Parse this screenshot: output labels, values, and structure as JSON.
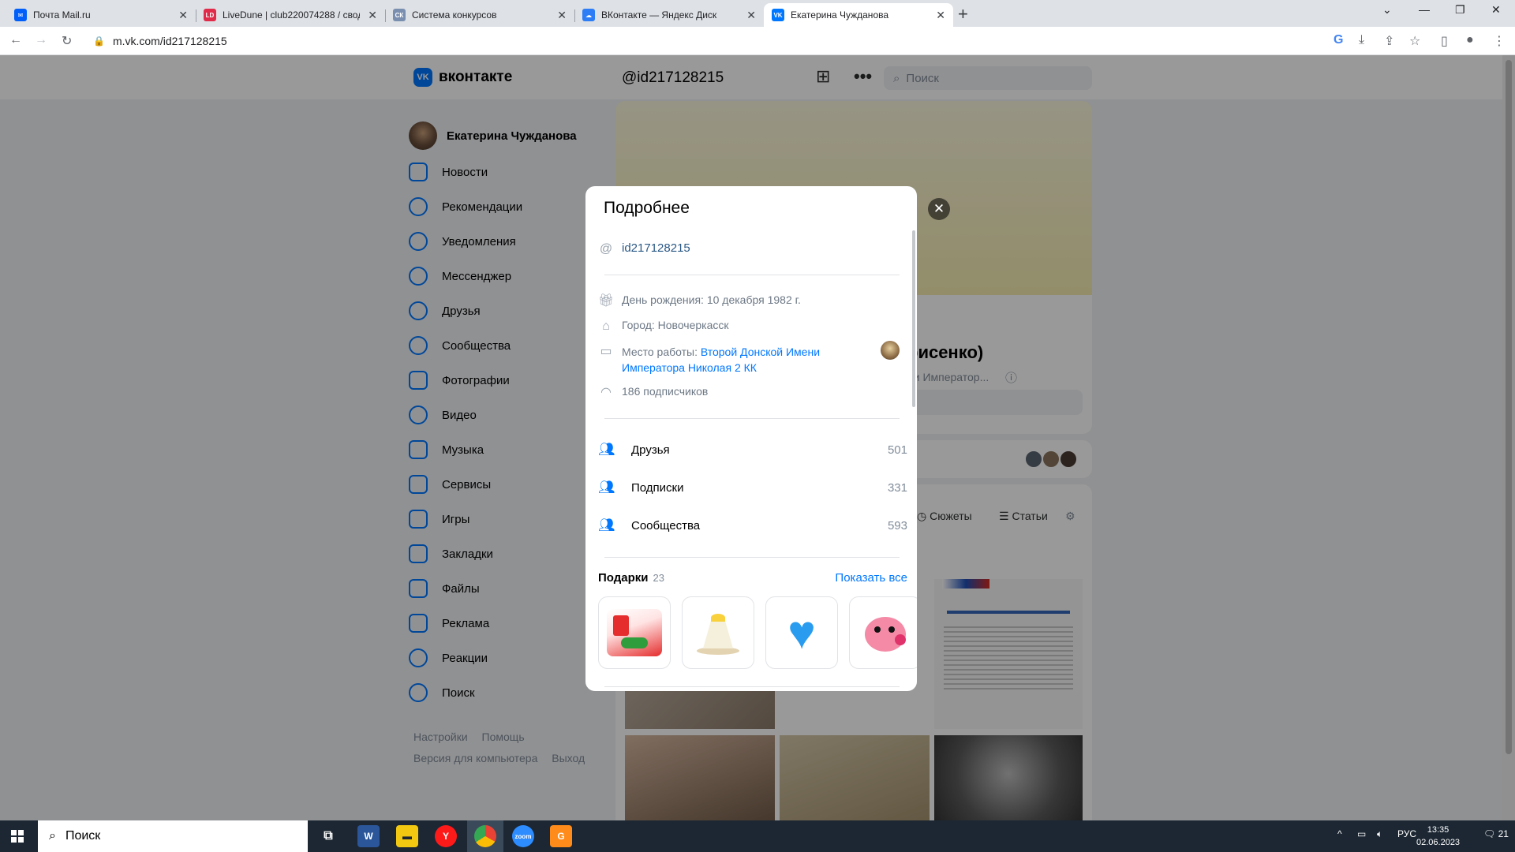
{
  "browser": {
    "tabs": [
      {
        "label": "Почта Mail.ru",
        "favicon_color": "#005ff9",
        "favicon_letter": "✉"
      },
      {
        "label": "LiveDune | club220074288 / свод",
        "favicon_color": "#e02b4a",
        "favicon_letter": "LD"
      },
      {
        "label": "Система конкурсов",
        "favicon_color": "#7a8fb0",
        "favicon_letter": "СК"
      },
      {
        "label": "ВКонтакте — Яндекс Диск",
        "favicon_color": "#2d7df6",
        "favicon_letter": "☁"
      },
      {
        "label": "Екатерина Чужданова",
        "favicon_color": "#0077ff",
        "favicon_letter": "VK"
      }
    ],
    "url": "m.vk.com/id217128215"
  },
  "vk_header": {
    "logo_text": "вконтакте",
    "handle": "@id217128215",
    "search_placeholder": "Поиск"
  },
  "sidebar": {
    "user_name": "Екатерина Чужданова",
    "items": [
      {
        "label": "Новости"
      },
      {
        "label": "Рекомендации"
      },
      {
        "label": "Уведомления"
      },
      {
        "label": "Мессенджер"
      },
      {
        "label": "Друзья"
      },
      {
        "label": "Сообщества"
      },
      {
        "label": "Фотографии"
      },
      {
        "label": "Видео"
      },
      {
        "label": "Музыка"
      },
      {
        "label": "Сервисы"
      },
      {
        "label": "Игры"
      },
      {
        "label": "Закладки"
      },
      {
        "label": "Файлы"
      },
      {
        "label": "Реклама"
      },
      {
        "label": "Реакции"
      },
      {
        "label": "Поиск"
      }
    ],
    "footer": {
      "settings": "Настройки",
      "help": "Помощь",
      "desktop": "Версия для компьютера",
      "logout": "Выход"
    }
  },
  "profile_behind": {
    "name_fragment": "рисенко)",
    "sub_fragment": "ни Император..."
  },
  "content_tabs": {
    "stories": "Сюжеты",
    "articles": "Статьи"
  },
  "modal": {
    "title": "Подробнее",
    "screen_name": "id217128215",
    "birthday": "День рождения: 10 декабря 1982 г.",
    "city": "Город: Новочеркасск",
    "work_prefix": "Место работы: ",
    "work_link_line1": "Второй Донской Имени",
    "work_link_line2": "Императора Николая 2 КК",
    "followers": "186 подписчиков",
    "stats": [
      {
        "label": "Друзья",
        "count": "501"
      },
      {
        "label": "Подписки",
        "count": "331"
      },
      {
        "label": "Сообщества",
        "count": "593"
      }
    ],
    "gifts": {
      "title": "Подарки",
      "count": "23",
      "show_all": "Показать все"
    }
  },
  "taskbar": {
    "search_placeholder": "Поиск",
    "lang": "РУС",
    "time": "13:35",
    "date": "02.06.2023",
    "notifications": "21"
  }
}
